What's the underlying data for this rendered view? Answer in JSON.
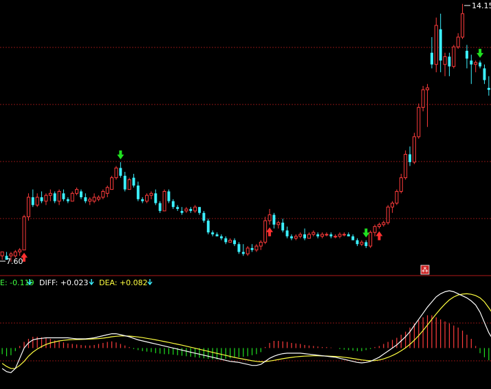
{
  "colors": {
    "background": "#000000",
    "up": "#ff3c3c",
    "down": "#3cf0ff",
    "grid": "#8a1515",
    "separator": "#b01818",
    "text": "#ffffff",
    "diff_line": "#ffffff",
    "dea_line": "#ffff40",
    "macd_label": "#40ff40",
    "dea_label": "#ffff40",
    "buy_arrow": "#ff3030",
    "sell_arrow": "#20e020",
    "marker_badge": "#cc2222"
  },
  "chart_data": [
    {
      "type": "candlestick",
      "title": "",
      "xlabel": "",
      "ylabel": "",
      "ylim": [
        7.3,
        14.25
      ],
      "grid": true,
      "annotations": {
        "max_label": "14.15",
        "min_label": "7.60"
      },
      "candles": [
        [
          7.7,
          7.8,
          7.6,
          7.8
        ],
        [
          7.7,
          7.8,
          7.6,
          7.6
        ],
        [
          7.7,
          7.8,
          7.55,
          7.75
        ],
        [
          7.7,
          7.85,
          7.65,
          7.8
        ],
        [
          7.8,
          7.9,
          7.7,
          7.85
        ],
        [
          7.85,
          8.75,
          7.85,
          8.7
        ],
        [
          8.7,
          9.3,
          8.6,
          9.2
        ],
        [
          9.2,
          9.4,
          8.95,
          9.0
        ],
        [
          9.0,
          9.3,
          8.95,
          9.2
        ],
        [
          9.2,
          9.35,
          9.05,
          9.1
        ],
        [
          9.1,
          9.3,
          9.0,
          9.25
        ],
        [
          9.25,
          9.4,
          9.1,
          9.3
        ],
        [
          9.3,
          9.35,
          9.05,
          9.1
        ],
        [
          9.1,
          9.4,
          9.0,
          9.35
        ],
        [
          9.3,
          9.4,
          9.1,
          9.15
        ],
        [
          9.15,
          9.2,
          9.05,
          9.1
        ],
        [
          9.1,
          9.35,
          9.1,
          9.3
        ],
        [
          9.3,
          9.45,
          9.25,
          9.4
        ],
        [
          9.35,
          9.4,
          9.15,
          9.2
        ],
        [
          9.2,
          9.3,
          9.05,
          9.1
        ],
        [
          9.1,
          9.2,
          9.0,
          9.15
        ],
        [
          9.1,
          9.3,
          9.05,
          9.2
        ],
        [
          9.15,
          9.25,
          9.1,
          9.2
        ],
        [
          9.2,
          9.4,
          9.15,
          9.35
        ],
        [
          9.3,
          9.5,
          9.2,
          9.45
        ],
        [
          9.4,
          9.75,
          9.4,
          9.7
        ],
        [
          9.7,
          10.0,
          9.65,
          9.95
        ],
        [
          9.95,
          10.1,
          9.7,
          9.75
        ],
        [
          9.75,
          9.85,
          9.35,
          9.4
        ],
        [
          9.4,
          9.7,
          9.4,
          9.65
        ],
        [
          9.7,
          9.8,
          9.45,
          9.5
        ],
        [
          9.5,
          9.6,
          9.1,
          9.15
        ],
        [
          9.15,
          9.2,
          9.05,
          9.1
        ],
        [
          9.1,
          9.3,
          9.05,
          9.25
        ],
        [
          9.25,
          9.35,
          9.15,
          9.3
        ],
        [
          9.3,
          9.4,
          9.0,
          9.05
        ],
        [
          9.05,
          9.1,
          8.8,
          8.85
        ],
        [
          8.85,
          9.4,
          8.85,
          9.35
        ],
        [
          9.35,
          9.4,
          9.05,
          9.1
        ],
        [
          9.1,
          9.15,
          8.9,
          8.95
        ],
        [
          8.95,
          9.0,
          8.85,
          8.9
        ],
        [
          8.85,
          8.95,
          8.75,
          8.8
        ],
        [
          8.85,
          8.95,
          8.8,
          8.9
        ],
        [
          8.9,
          8.95,
          8.8,
          8.85
        ],
        [
          8.85,
          9.0,
          8.8,
          8.95
        ],
        [
          8.95,
          8.95,
          8.75,
          8.8
        ],
        [
          8.8,
          8.85,
          8.55,
          8.6
        ],
        [
          8.6,
          8.65,
          8.25,
          8.3
        ],
        [
          8.3,
          8.35,
          8.2,
          8.25
        ],
        [
          8.25,
          8.3,
          8.2,
          8.2
        ],
        [
          8.2,
          8.25,
          8.1,
          8.15
        ],
        [
          8.15,
          8.2,
          8.0,
          8.05
        ],
        [
          8.05,
          8.15,
          8.05,
          8.1
        ],
        [
          8.1,
          8.15,
          7.95,
          8.0
        ],
        [
          8.0,
          8.05,
          7.75,
          7.8
        ],
        [
          7.8,
          8.0,
          7.7,
          7.75
        ],
        [
          7.75,
          7.95,
          7.7,
          7.9
        ],
        [
          7.9,
          8.0,
          7.8,
          7.85
        ],
        [
          7.85,
          8.0,
          7.8,
          7.95
        ],
        [
          7.95,
          8.1,
          7.85,
          8.05
        ],
        [
          8.05,
          8.7,
          8.0,
          8.6
        ],
        [
          8.6,
          8.9,
          8.5,
          8.75
        ],
        [
          8.75,
          8.8,
          8.4,
          8.5
        ],
        [
          8.5,
          8.6,
          8.4,
          8.55
        ],
        [
          8.55,
          8.65,
          8.3,
          8.35
        ],
        [
          8.35,
          8.45,
          8.15,
          8.2
        ],
        [
          8.2,
          8.25,
          8.1,
          8.15
        ],
        [
          8.15,
          8.25,
          8.1,
          8.2
        ],
        [
          8.2,
          8.3,
          8.15,
          8.25
        ],
        [
          8.25,
          8.4,
          8.1,
          8.15
        ],
        [
          8.15,
          8.3,
          8.15,
          8.25
        ],
        [
          8.25,
          8.35,
          8.2,
          8.3
        ],
        [
          8.25,
          8.3,
          8.15,
          8.2
        ],
        [
          8.2,
          8.3,
          8.15,
          8.25
        ],
        [
          8.25,
          8.3,
          8.2,
          8.25
        ],
        [
          8.25,
          8.3,
          8.15,
          8.2
        ],
        [
          8.2,
          8.25,
          8.15,
          8.2
        ],
        [
          8.2,
          8.3,
          8.15,
          8.25
        ],
        [
          8.25,
          8.3,
          8.2,
          8.25
        ],
        [
          8.25,
          8.3,
          8.2,
          8.2
        ],
        [
          8.2,
          8.25,
          8.1,
          8.1
        ],
        [
          8.1,
          8.15,
          7.95,
          8.0
        ],
        [
          8.0,
          8.1,
          7.95,
          8.05
        ],
        [
          8.05,
          8.1,
          7.9,
          7.95
        ],
        [
          7.95,
          8.35,
          7.9,
          8.3
        ],
        [
          8.3,
          8.5,
          8.2,
          8.45
        ],
        [
          8.45,
          8.55,
          8.4,
          8.5
        ],
        [
          8.5,
          8.6,
          8.45,
          8.55
        ],
        [
          8.55,
          9.0,
          8.5,
          8.95
        ],
        [
          8.95,
          9.1,
          8.8,
          9.05
        ],
        [
          9.05,
          9.4,
          9.0,
          9.35
        ],
        [
          9.35,
          9.8,
          9.3,
          9.7
        ],
        [
          9.7,
          10.4,
          9.65,
          10.3
        ],
        [
          10.3,
          10.5,
          10.0,
          10.1
        ],
        [
          10.1,
          10.85,
          10.05,
          10.75
        ],
        [
          10.75,
          11.6,
          10.7,
          11.5
        ],
        [
          11.5,
          12.05,
          11.4,
          11.95
        ],
        [
          11.95,
          12.1,
          11.0,
          12.0
        ],
        [
          12.9,
          13.3,
          12.5,
          12.6
        ],
        [
          12.6,
          13.8,
          12.4,
          13.6
        ],
        [
          13.5,
          13.9,
          12.4,
          12.7
        ],
        [
          12.6,
          12.9,
          12.3,
          12.8
        ],
        [
          12.8,
          12.9,
          12.3,
          12.55
        ],
        [
          12.55,
          13.1,
          12.5,
          13.05
        ],
        [
          13.05,
          13.4,
          13.0,
          13.3
        ],
        [
          13.3,
          14.15,
          13.25,
          13.9
        ],
        [
          12.95,
          13.1,
          12.5,
          12.75
        ],
        [
          12.7,
          12.85,
          12.1,
          12.6
        ],
        [
          12.6,
          12.7,
          12.4,
          12.65
        ],
        [
          12.65,
          12.7,
          12.5,
          12.55
        ],
        [
          12.5,
          12.6,
          12.1,
          12.2
        ],
        [
          12.0,
          12.3,
          11.8,
          11.95
        ]
      ],
      "buy_signals": [
        5,
        61,
        86
      ],
      "sell_signals": [
        27,
        83,
        109
      ]
    },
    {
      "type": "macd",
      "labels": {
        "macd": "E: -0.119",
        "diff": "DIFF: +0.023",
        "dea": "DEA: +0.082"
      },
      "indicator_icons": [
        "down-arrow-icon",
        "down-arrow-icon",
        "down-arrow-icon"
      ],
      "ylim": [
        -0.4,
        0.58
      ],
      "histogram": [
        -0.06,
        -0.08,
        -0.07,
        -0.03,
        0.02,
        0.06,
        0.09,
        0.11,
        0.11,
        0.105,
        0.1,
        0.09,
        0.075,
        0.065,
        0.055,
        0.045,
        0.04,
        0.035,
        0.03,
        0.025,
        0.025,
        0.03,
        0.04,
        0.05,
        0.06,
        0.065,
        0.055,
        0.04,
        0.025,
        0.01,
        -0.01,
        -0.02,
        -0.03,
        -0.035,
        -0.04,
        -0.05,
        -0.055,
        -0.06,
        -0.06,
        -0.065,
        -0.07,
        -0.075,
        -0.08,
        -0.085,
        -0.09,
        -0.095,
        -0.1,
        -0.105,
        -0.11,
        -0.11,
        -0.11,
        -0.105,
        -0.1,
        -0.095,
        -0.09,
        -0.085,
        -0.08,
        -0.07,
        -0.06,
        -0.04,
        0.01,
        0.05,
        0.07,
        0.07,
        0.065,
        0.06,
        0.05,
        0.045,
        0.04,
        0.03,
        0.025,
        0.02,
        0.015,
        0.01,
        0.01,
        0.005,
        0.0,
        -0.01,
        -0.015,
        -0.02,
        -0.025,
        -0.03,
        -0.03,
        -0.02,
        -0.01,
        0.01,
        0.02,
        0.04,
        0.06,
        0.08,
        0.1,
        0.13,
        0.16,
        0.2,
        0.24,
        0.27,
        0.3,
        0.32,
        0.32,
        0.3,
        0.28,
        0.26,
        0.24,
        0.22,
        0.2,
        0.17,
        0.13,
        0.09,
        0.02,
        -0.05,
        -0.09,
        -0.119
      ],
      "diff": [
        -0.2,
        -0.23,
        -0.24,
        -0.2,
        -0.1,
        0.0,
        0.05,
        0.08,
        0.09,
        0.095,
        0.1,
        0.1,
        0.1,
        0.1,
        0.1,
        0.1,
        0.095,
        0.09,
        0.09,
        0.09,
        0.095,
        0.1,
        0.11,
        0.12,
        0.13,
        0.14,
        0.14,
        0.13,
        0.12,
        0.11,
        0.095,
        0.08,
        0.07,
        0.06,
        0.05,
        0.04,
        0.03,
        0.02,
        0.01,
        0.0,
        -0.01,
        -0.02,
        -0.03,
        -0.04,
        -0.05,
        -0.06,
        -0.07,
        -0.08,
        -0.09,
        -0.1,
        -0.11,
        -0.12,
        -0.13,
        -0.135,
        -0.14,
        -0.15,
        -0.16,
        -0.17,
        -0.17,
        -0.16,
        -0.13,
        -0.1,
        -0.08,
        -0.065,
        -0.055,
        -0.05,
        -0.05,
        -0.05,
        -0.05,
        -0.055,
        -0.06,
        -0.065,
        -0.07,
        -0.075,
        -0.08,
        -0.085,
        -0.09,
        -0.1,
        -0.11,
        -0.12,
        -0.13,
        -0.14,
        -0.145,
        -0.14,
        -0.13,
        -0.11,
        -0.09,
        -0.06,
        -0.03,
        0.0,
        0.03,
        0.07,
        0.11,
        0.16,
        0.22,
        0.28,
        0.34,
        0.4,
        0.45,
        0.5,
        0.53,
        0.55,
        0.56,
        0.55,
        0.53,
        0.51,
        0.49,
        0.46,
        0.42,
        0.35,
        0.25,
        0.15,
        0.08,
        0.023
      ],
      "dea": [
        -0.15,
        -0.18,
        -0.2,
        -0.2,
        -0.17,
        -0.13,
        -0.08,
        -0.04,
        -0.01,
        0.015,
        0.035,
        0.05,
        0.06,
        0.07,
        0.075,
        0.08,
        0.082,
        0.083,
        0.084,
        0.085,
        0.087,
        0.09,
        0.093,
        0.097,
        0.103,
        0.11,
        0.115,
        0.118,
        0.118,
        0.117,
        0.113,
        0.108,
        0.102,
        0.095,
        0.088,
        0.08,
        0.072,
        0.063,
        0.055,
        0.046,
        0.037,
        0.028,
        0.018,
        0.008,
        -0.002,
        -0.012,
        -0.022,
        -0.032,
        -0.042,
        -0.052,
        -0.062,
        -0.072,
        -0.082,
        -0.092,
        -0.1,
        -0.108,
        -0.116,
        -0.124,
        -0.13,
        -0.134,
        -0.133,
        -0.127,
        -0.12,
        -0.112,
        -0.104,
        -0.097,
        -0.091,
        -0.086,
        -0.082,
        -0.079,
        -0.077,
        -0.076,
        -0.076,
        -0.077,
        -0.078,
        -0.08,
        -0.082,
        -0.085,
        -0.09,
        -0.095,
        -0.102,
        -0.109,
        -0.116,
        -0.121,
        -0.124,
        -0.123,
        -0.117,
        -0.106,
        -0.091,
        -0.073,
        -0.052,
        -0.027,
        0.002,
        0.036,
        0.076,
        0.121,
        0.171,
        0.225,
        0.279,
        0.333,
        0.384,
        0.43,
        0.47,
        0.499,
        0.518,
        0.527,
        0.53,
        0.525,
        0.512,
        0.49,
        0.452,
        0.393,
        0.33,
        0.27
      ]
    }
  ]
}
